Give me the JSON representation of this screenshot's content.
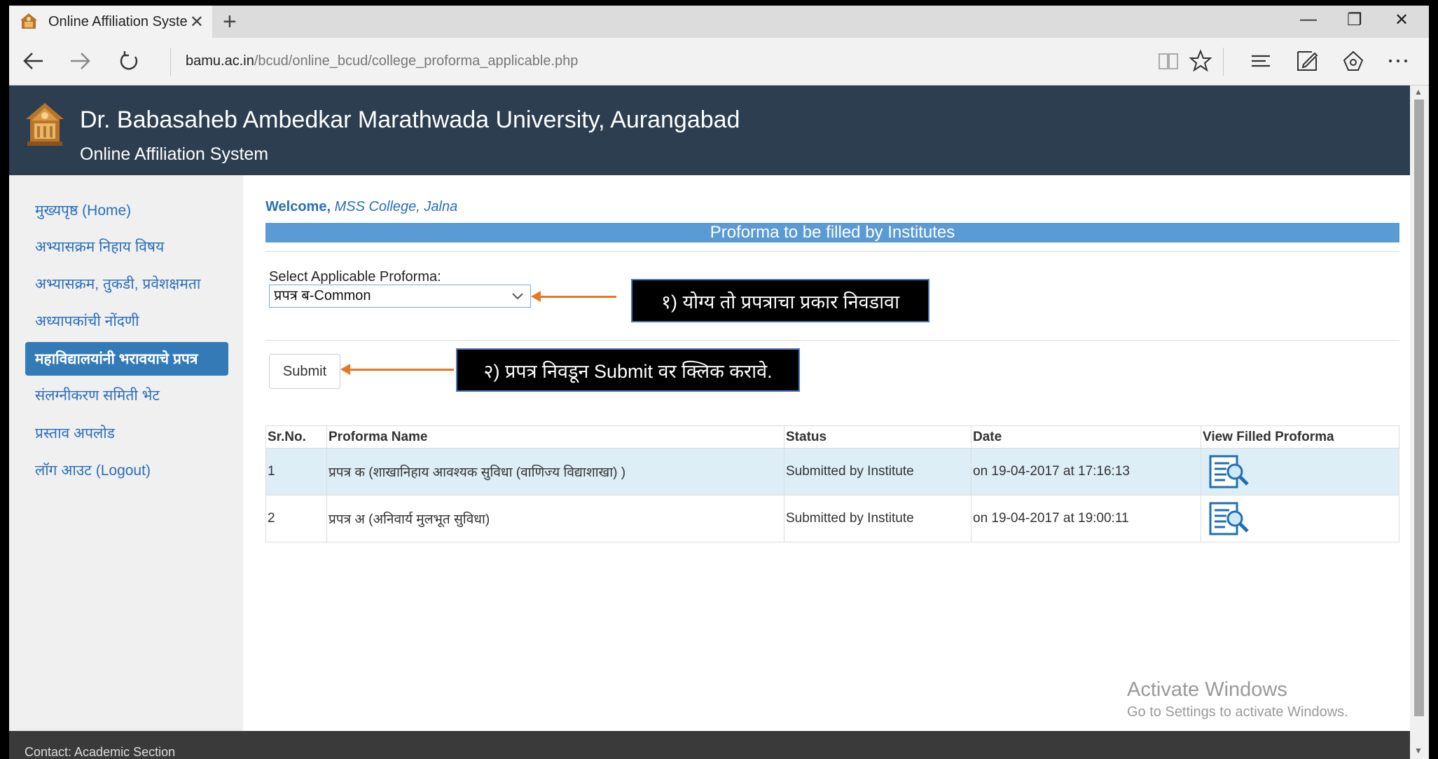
{
  "browser": {
    "tab_title": "Online Affiliation System",
    "tab_close": "✕",
    "new_tab": "+",
    "minimize": "—",
    "maximize": "❐",
    "close": "✕",
    "url_domain": "bamu.ac.in",
    "url_path": "/bcud/online_bcud/college_proforma_applicable.php",
    "icons": [
      "back-icon",
      "forward-icon",
      "refresh-icon",
      "reading-view-icon",
      "favorites-star-icon",
      "hub-icon",
      "web-note-icon",
      "share-icon",
      "more-icon"
    ]
  },
  "header": {
    "title": "Dr. Babasaheb Ambedkar Marathwada University, Aurangabad",
    "subtitle": "Online Affiliation System"
  },
  "sidebar": {
    "items": [
      {
        "label": "मुख्यपृष्ठ (Home)"
      },
      {
        "label": "अभ्यासक्रम निहाय विषय"
      },
      {
        "label": "अभ्यासक्रम, तुकडी, प्रवेशक्षमता"
      },
      {
        "label": "अध्यापकांची नोंदणी"
      },
      {
        "label": "महाविद्यालयांनी भरावयाचे प्रपत्र",
        "active": true
      },
      {
        "label": "संलग्नीकरण समिती भेट"
      },
      {
        "label": "प्रस्ताव अपलोड"
      },
      {
        "label": "लॉग आउट (Logout)"
      }
    ]
  },
  "main": {
    "welcome_label": "Welcome,",
    "welcome_name": "MSS College, Jalna",
    "section_title": "Proforma to be filled by Institutes",
    "select_label": "Select Applicable Proforma:",
    "select_value": "प्रपत्र ब-Common",
    "submit_label": "Submit",
    "callout_1": "१) योग्य तो प्रपत्राचा प्रकार निवडावा",
    "callout_2": "२) प्रपत्र निवडून Submit वर क्लिक करावे.",
    "table": {
      "headers": [
        "Sr.No.",
        "Proforma Name",
        "Status",
        "Date",
        "View Filled Proforma"
      ],
      "rows": [
        {
          "sr": "1",
          "name": "प्रपत्र क (शाखानिहाय आवश्यक सुविधा (वाणिज्य विद्याशाखा) )",
          "status": "Submitted by Institute",
          "date": "on 19-04-2017 at 17:16:13"
        },
        {
          "sr": "2",
          "name": "प्रपत्र अ (अनिवार्य मुलभूत सुविधा)",
          "status": "Submitted by Institute",
          "date": "on 19-04-2017 at 19:00:11"
        }
      ]
    }
  },
  "watermark": {
    "line1": "Activate Windows",
    "line2": "Go to Settings to activate Windows."
  },
  "footer": {
    "text": "Contact: Academic Section"
  },
  "colors": {
    "header_bg": "#2c3e50",
    "section_bar": "#5b9bd5",
    "sidebar_active": "#337ab7",
    "link": "#2a6ebb",
    "callout_bg": "#000000",
    "arrow": "#e87722",
    "row_alt": "#ddeef7"
  }
}
